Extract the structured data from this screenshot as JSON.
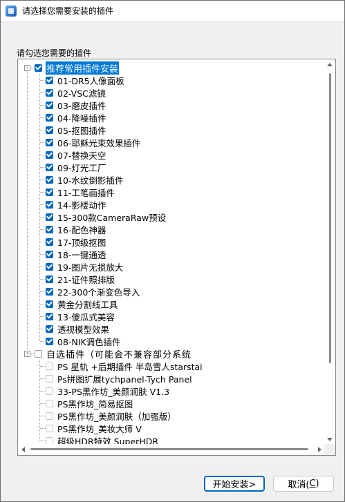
{
  "window": {
    "title": "请选择您需要安装的插件"
  },
  "prompt": "请勾选您需要的插件",
  "group1": {
    "label": "推荐常用插件安装",
    "expander": "-",
    "items": [
      "01-DR5人像面板",
      "02-VSC滤镜",
      "03-磨皮插件",
      "04-降噪插件",
      "05-抠图插件",
      "06-耶稣光束效果插件",
      "07-替换天空",
      "09-灯光工厂",
      "10-水纹倒影插件",
      "11-工笔画插件",
      "14-影楼动作",
      "15-300款CameraRaw预设",
      "16-配色神器",
      "17-顶级抠图",
      "18-一键通透",
      "19-图片无损放大",
      "21-证件照排版",
      "22-300个渐变色导入",
      "黄金分割线工具",
      "13-傻瓜式美容",
      "透视模型效果",
      "08-NIK调色插件"
    ]
  },
  "group2": {
    "label": "自选插件（可能会不兼容部分系统",
    "expander": "-",
    "items": [
      "PS 星轨 +后期插件 半岛雪人starstai",
      "Ps拼图扩展tychpanel-Tych Panel",
      "33-PS黑作坊_美颜润肤 V1.3",
      "PS黑作坊_简易抠图",
      "PS黑作坊_美颜润肤（加强版）",
      "PS黑作坊_美妆大师 V",
      "超级HDR特效 SuperHDR"
    ]
  },
  "buttons": {
    "install": "开始安装>",
    "cancel_prefix": "取消(",
    "cancel_key": "C",
    "cancel_suffix": ")"
  },
  "colors": {
    "accent": "#0067c0",
    "selection": "#0078d7"
  }
}
